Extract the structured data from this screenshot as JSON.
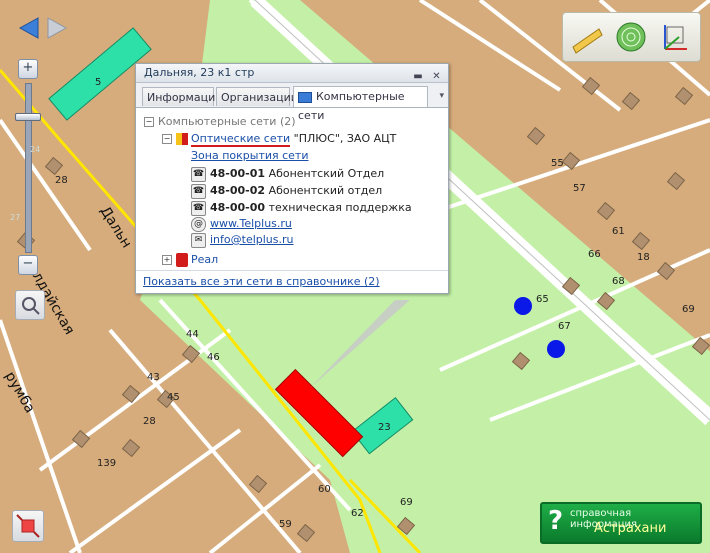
{
  "map": {
    "colors": {
      "land": "#d6ac7c",
      "park": "#c3f0a6",
      "road": "#ffffff",
      "selected_building": "#ff0000",
      "building": "#2de0a8",
      "node": "#0a18e8"
    },
    "streets": [
      "Дальн",
      "алдайская",
      "румба"
    ],
    "house_numbers": [
      "5",
      "28",
      "44",
      "46",
      "43",
      "45",
      "28",
      "139",
      "60",
      "59",
      "62",
      "69",
      "23",
      "55",
      "57",
      "61",
      "66",
      "18",
      "68",
      "65",
      "67",
      "69"
    ],
    "zoom_ticks": [
      "24",
      "27"
    ]
  },
  "nav": {
    "back_icon": "arrow-left-icon",
    "forward_icon": "arrow-right-icon",
    "zoom_in": "+",
    "zoom_out": "−"
  },
  "popup": {
    "title": "Дальняя, 23 к1 стр",
    "tabs": [
      "Информация",
      "Организации",
      "Компьютерные сети"
    ],
    "tree": {
      "root": "Компьютерные сети (2)",
      "provider1": {
        "name": "Оптические сети",
        "suffix": "\"ПЛЮС\", ЗАО АЦТ",
        "coverage": "Зона покрытия сети",
        "phones": [
          {
            "number": "48-00-01",
            "label": "Абонентский Отдел"
          },
          {
            "number": "48-00-02",
            "label": "Абонентский отдел"
          },
          {
            "number": "48-00-00",
            "label": "техническая поддержка"
          }
        ],
        "website": "www.Telplus.ru",
        "email": "info@telplus.ru"
      },
      "provider2": {
        "name": "Реал"
      }
    },
    "footer_link": "Показать все эти сети в справочнике (2)"
  },
  "banner": {
    "q": "?",
    "small": "справочная информация",
    "big": "Астрахани"
  }
}
